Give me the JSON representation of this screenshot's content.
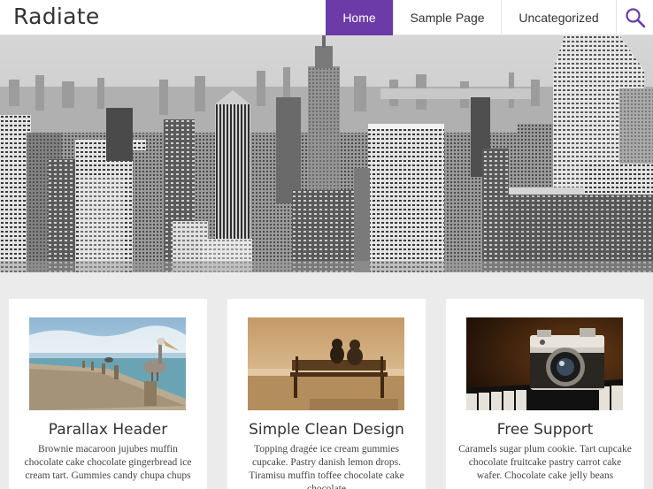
{
  "site": {
    "title": "Radiate"
  },
  "nav": {
    "items": [
      {
        "label": "Home",
        "active": true
      },
      {
        "label": "Sample Page",
        "active": false
      },
      {
        "label": "Uncategorized",
        "active": false
      }
    ],
    "search_icon": "search-icon"
  },
  "colors": {
    "accent": "#6c3ba8",
    "page_background": "#ebebeb",
    "header_background": "#ffffff",
    "text": "#333333"
  },
  "hero": {
    "image": "city-skyline-photo"
  },
  "features": [
    {
      "image": "pelican-on-pier-photo",
      "title": "Parallax Header",
      "text": "Brownie macaroon jujubes muffin chocolate cake chocolate gingerbread ice cream tart. Gummies candy chupa chups"
    },
    {
      "image": "couple-on-bench-photo",
      "title": "Simple Clean Design",
      "text": "Topping dragée ice cream gummies cupcake. Pastry danish lemon drops. Tiramisu muffin toffee chocolate cake chocolate"
    },
    {
      "image": "vintage-camera-photo",
      "title": "Free Support",
      "text": "Caramels sugar plum cookie. Tart cupcake chocolate fruitcake pastry carrot cake wafer. Chocolate cake jelly beans"
    }
  ]
}
